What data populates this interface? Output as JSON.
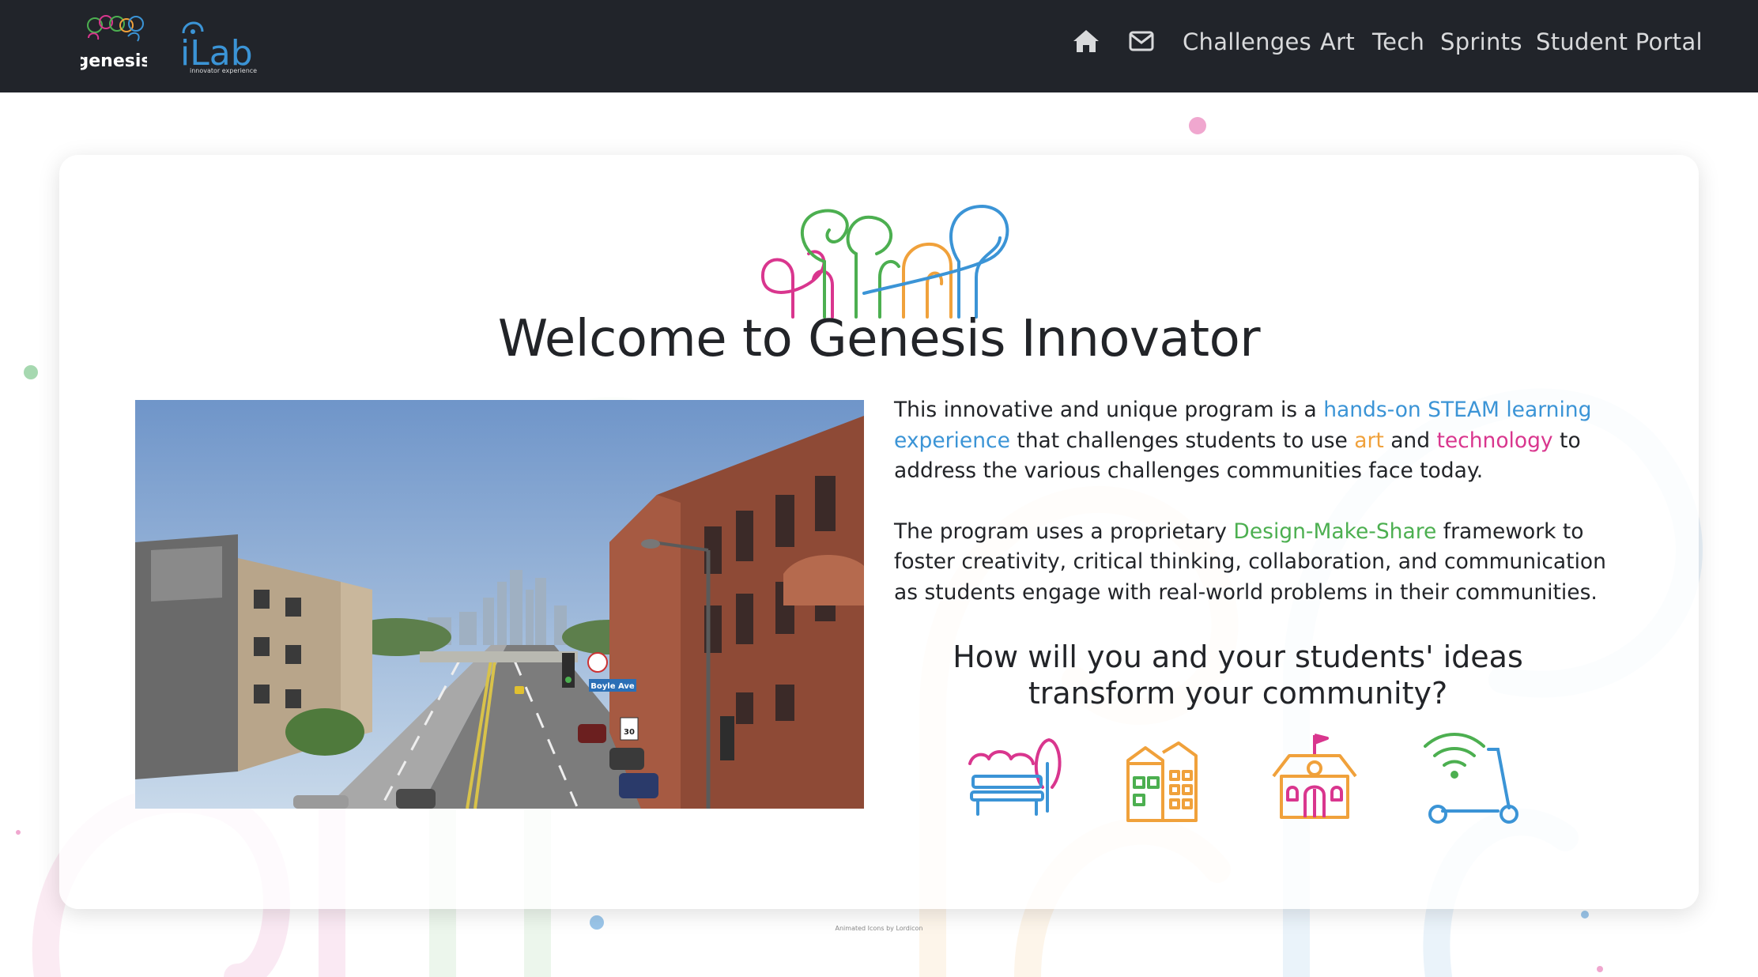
{
  "nav": {
    "brand_logo_name": "genesis-logo",
    "brand_logo_text": "genesis",
    "ilab_logo_text": "iLab",
    "ilab_logo_subtext": "innovator experience",
    "home_icon": "home-icon",
    "mail_icon": "mail-icon",
    "links": [
      "Challenges",
      "Art",
      "Tech",
      "Sprints",
      "Student Portal"
    ]
  },
  "hero": {
    "title": "Welcome to Genesis Innovator",
    "paragraph1": {
      "part1": "This innovative and unique program is a ",
      "link1": "hands-on STEAM learning experience",
      "part2": " that challenges students to use ",
      "link2": "art",
      "part3": " and ",
      "link3": "technology",
      "part4": " to address the various challenges communities face today."
    },
    "paragraph2": {
      "part1": "The program uses a proprietary ",
      "link1": "Design-Make-Share",
      "part2": " framework to foster creativity, critical thinking, collaboration, and communication as students engage with real-world problems in their communities."
    },
    "question_line1": "How will you and your students' ideas",
    "question_line2": "transform your community?",
    "icons": [
      "park-bench-icon",
      "buildings-icon",
      "school-house-icon",
      "scooter-wifi-icon"
    ],
    "street_sign_text": "Boyle Ave",
    "speed_sign_text": "30"
  },
  "footer": {
    "credit": "Animated Icons by Lordicon"
  },
  "colors": {
    "nav_bg": "#21242a",
    "blue": "#3b94d6",
    "orange": "#f0a13b",
    "pink": "#d9368e",
    "green": "#4caf50"
  }
}
